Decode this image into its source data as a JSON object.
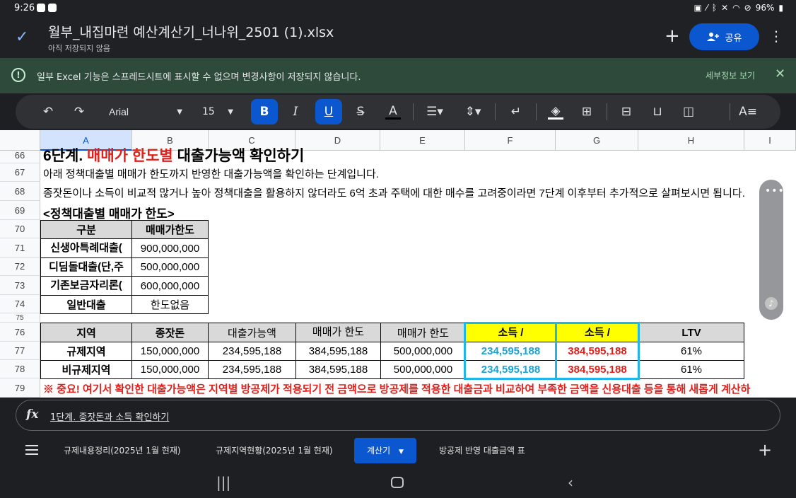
{
  "status": {
    "time": "9:26",
    "battery": "96%"
  },
  "title": {
    "filename": "월부_내집마련 예산계산기_너나위_2501 (1).xlsx",
    "subtitle": "아직 저장되지 않음",
    "share": "공유"
  },
  "notice": {
    "text": "일부 Excel 기능은 스프레드시트에 표시할 수 없으며 변경사항이 저장되지 않습니다.",
    "detail": "세부정보 보기"
  },
  "toolbar": {
    "font": "Arial",
    "size": "15",
    "bold": "B",
    "italic": "I",
    "underline": "U",
    "textcolor": "A"
  },
  "colheaders": [
    "A",
    "B",
    "C",
    "D",
    "E",
    "F",
    "G",
    "H",
    "I"
  ],
  "rows": [
    "66",
    "67",
    "68",
    "69",
    "70",
    "71",
    "72",
    "73",
    "74",
    "75",
    "76",
    "77",
    "78",
    "79"
  ],
  "sheet": {
    "r66_a": "6단계. ",
    "r66_b": "매매가 한도별",
    "r66_c": " 대출가능액 확인하기",
    "r67": "아래 정책대출별 매매가 한도까지 반영한 대출가능액을 확인하는 단계입니다.",
    "r68": "종잣돈이나 소득이 비교적 많거나 높아 정책대출을 활용하지 않더라도 6억 초과 주택에 대한 매수를 고려중이라면 7단계 이후부터 추가적으로 살펴보시면 됩니다.",
    "r69": "<정책대출별 매매가 한도>",
    "policy_header": [
      "구분",
      "매매가한도"
    ],
    "policy_rows": [
      [
        "신생아특례대출(",
        "900,000,000"
      ],
      [
        "디딤돌대출(단,주",
        "500,000,000"
      ],
      [
        "기존보금자리론(",
        "600,000,000"
      ],
      [
        "일반대출",
        "한도없음"
      ]
    ],
    "main_header": [
      "지역",
      "종잣돈",
      "대출가능액",
      "매매가 한도",
      "매매가 한도",
      "소득 /",
      "소득 /",
      "LTV"
    ],
    "main_rows": [
      [
        "규제지역",
        "150,000,000",
        "234,595,188",
        "384,595,188",
        "500,000,000",
        "234,595,188",
        "384,595,188",
        "61%"
      ],
      [
        "비규제지역",
        "150,000,000",
        "234,595,188",
        "384,595,188",
        "500,000,000",
        "234,595,188",
        "384,595,188",
        "61%"
      ]
    ],
    "r79": "※ 중요! 여기서 확인한 대출가능액은 지역별 방공제가 적용되기 전 금액으로 방공제를 적용한 대출금과 비교하여 부족한 금액을 신용대출 등을 통해 새롭게 계산하"
  },
  "formula": {
    "fx": "fx",
    "content": "1단계. 종잣돈과 소득 확인하기"
  },
  "tabs": [
    "규제내용정리(2025년 1월 현재)",
    "규제지역현황(2025년 1월 현재)",
    "계산기",
    "방공제 반영 대출금액 표"
  ],
  "colors": {
    "blue_value": "#1aa3d4",
    "red_value": "#e0201b",
    "accent": "#0b57d0"
  }
}
